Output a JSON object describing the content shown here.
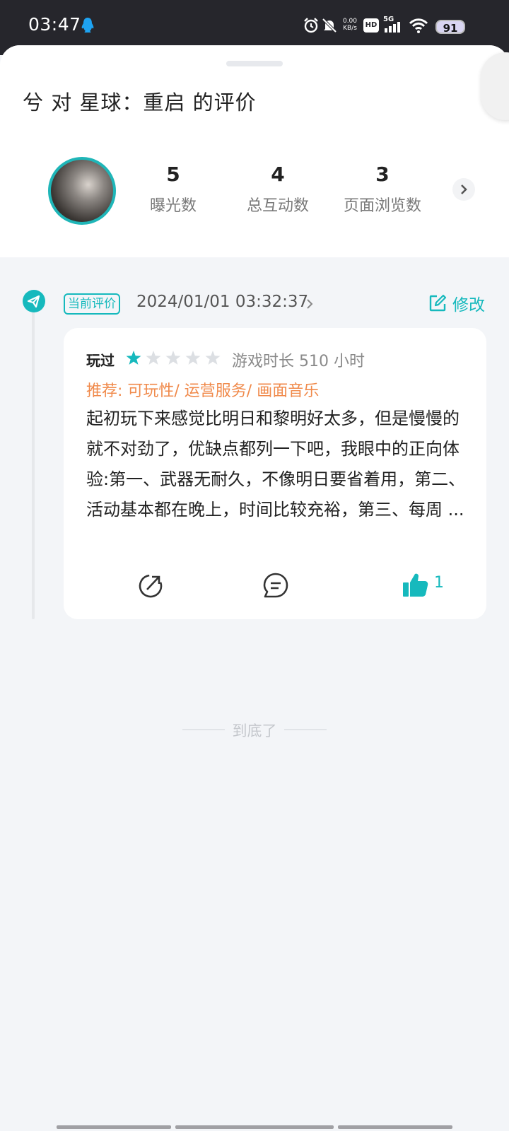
{
  "status_bar": {
    "time": "03:47",
    "network_speed_value": "0.00",
    "network_speed_unit": "KB/s",
    "hd_label": "HD",
    "signal_label": "5G",
    "battery": "91",
    "icons": [
      "qq-icon",
      "alarm-icon",
      "mute-icon",
      "hd-icon",
      "signal-icon",
      "wifi-icon",
      "battery-icon"
    ]
  },
  "header": {
    "title": "兮 对 星球：重启 的评价"
  },
  "stats": {
    "items": [
      {
        "value": "5",
        "label": "曝光数"
      },
      {
        "value": "4",
        "label": "总互动数"
      },
      {
        "value": "3",
        "label": "页面浏览数"
      }
    ]
  },
  "review": {
    "tag": "当前评价",
    "date": "2024/01/01 03:32:37",
    "edit_label": "修改",
    "played_label": "玩过",
    "rating": 1,
    "rating_max": 5,
    "playtime": "游戏时长 510 小时",
    "recommend": "推荐: 可玩性/ 运营服务/ 画面音乐",
    "text": "起初玩下来感觉比明日和黎明好太多，但是慢慢的就不对劲了，优缺点都列一下吧，我眼中的正向体验:第一、武器无耐久，不像明日要省着用，第二、活动基本都在晚上，时间比较充裕，第三、每周 ...",
    "like_count": "1"
  },
  "footer": {
    "end_text": "到底了"
  },
  "colors": {
    "accent": "#16b9bd",
    "recommend": "#f08a4b",
    "star_empty": "#dcdfe3",
    "background": "#f3f5f8"
  }
}
